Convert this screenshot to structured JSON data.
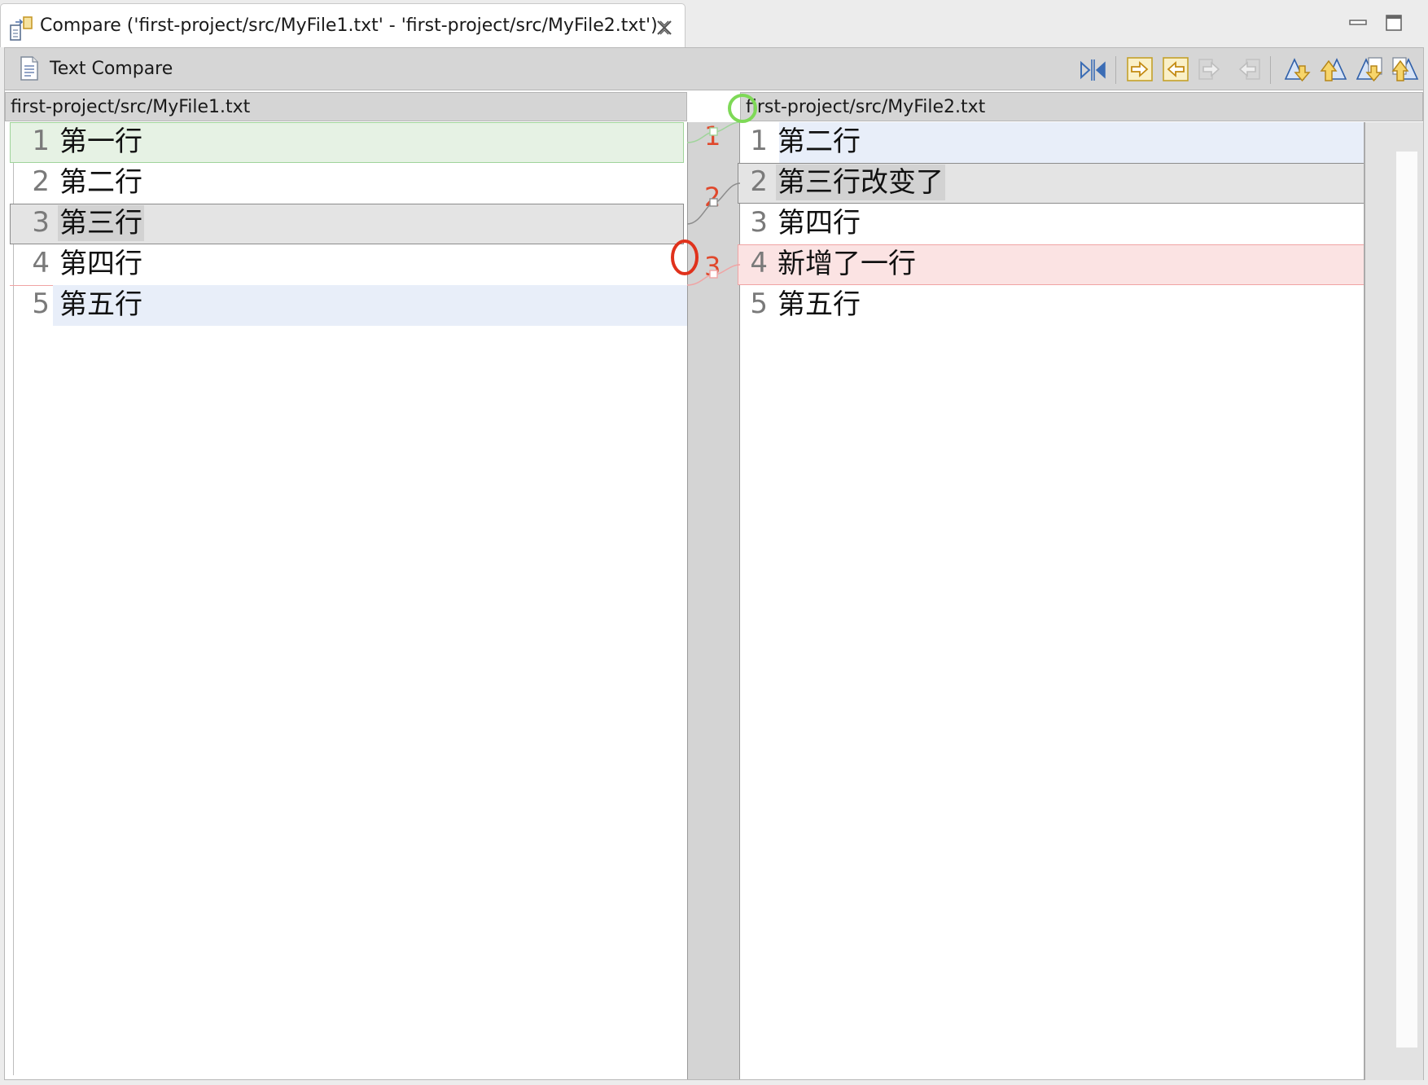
{
  "tab": {
    "title": "Compare ('first-project/src/MyFile1.txt' - 'first-project/src/MyFile2.txt')"
  },
  "toolbar": {
    "title": "Text Compare",
    "buttons": [
      {
        "icon": "swap-sides-icon",
        "enabled": true
      },
      {
        "icon": "copy-all-left-to-right-icon",
        "enabled": true
      },
      {
        "icon": "copy-all-right-to-left-icon",
        "enabled": true
      },
      {
        "icon": "copy-current-left-to-right-icon",
        "enabled": false
      },
      {
        "icon": "copy-current-right-to-left-icon",
        "enabled": false
      },
      {
        "icon": "next-difference-icon",
        "enabled": true
      },
      {
        "icon": "previous-difference-icon",
        "enabled": true
      },
      {
        "icon": "next-change-icon",
        "enabled": true
      },
      {
        "icon": "previous-change-icon",
        "enabled": true
      }
    ]
  },
  "left": {
    "header": "first-project/src/MyFile1.txt",
    "lines": [
      {
        "num": "1",
        "text": "第一行"
      },
      {
        "num": "2",
        "text": "第二行"
      },
      {
        "num": "3",
        "text": "第三行"
      },
      {
        "num": "4",
        "text": "第四行"
      },
      {
        "num": "5",
        "text": "第五行"
      }
    ]
  },
  "right": {
    "header": "first-project/src/MyFile2.txt",
    "lines": [
      {
        "num": "1",
        "text": "第二行"
      },
      {
        "num": "2",
        "text": "第三行改变了"
      },
      {
        "num": "3",
        "text": "第四行"
      },
      {
        "num": "4",
        "text": "新增了一行"
      },
      {
        "num": "5",
        "text": "第五行"
      }
    ]
  },
  "annotations": {
    "labels": [
      "1",
      "2",
      "3"
    ],
    "colors": {
      "label": "#e0482c",
      "green_circle": "#7ed957",
      "red_circle": "#e0321c"
    }
  },
  "colors": {
    "added_left_bg": "#e6f2e4",
    "added_left_border": "#9fd49a",
    "changed_bg": "#e4e4e4",
    "changed_text_bg": "#d2d2d2",
    "changed_border": "#8c8c8c",
    "inserted_right_bg": "#fbe3e3",
    "inserted_right_border": "#f0a4a4",
    "shifted_bg": "#e8eef9"
  }
}
